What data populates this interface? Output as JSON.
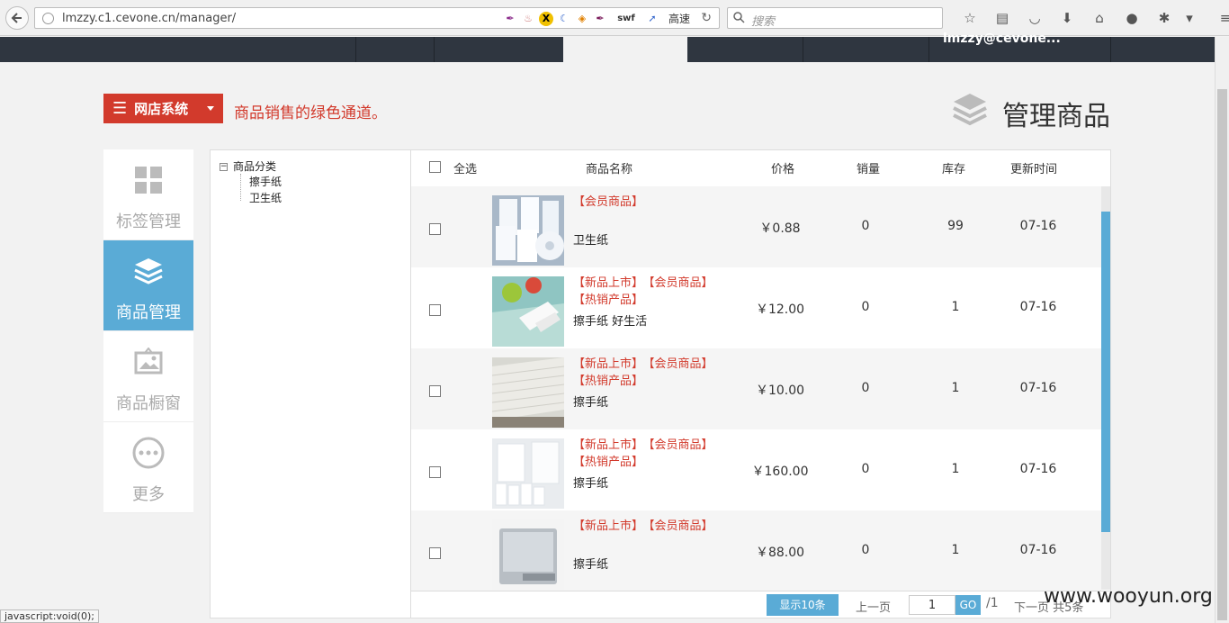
{
  "browser": {
    "url": "lmzzy.c1.cevone.cn/manager/",
    "speed_label": "高速",
    "search_placeholder": "搜索"
  },
  "header": {
    "user": "lmzzy@cevone..."
  },
  "page": {
    "system_button": "网店系统",
    "slogan": "商品销售的绿色通道。",
    "title": "管理商品"
  },
  "left_menu": {
    "items": [
      {
        "label": "标签管理",
        "icon": "grid-icon"
      },
      {
        "label": "商品管理",
        "icon": "layers-icon"
      },
      {
        "label": "商品橱窗",
        "icon": "picture-icon"
      },
      {
        "label": "更多",
        "icon": "more-icon"
      }
    ]
  },
  "tree": {
    "root": "商品分类",
    "children": [
      "擦手纸",
      "卫生纸"
    ]
  },
  "table": {
    "headers": {
      "select_all": "全选",
      "name": "商品名称",
      "price": "价格",
      "sales": "销量",
      "stock": "库存",
      "updated": "更新时间"
    },
    "rows": [
      {
        "tags": [
          "【会员商品】"
        ],
        "name": "卫生纸",
        "price": "￥0.88",
        "sales": "0",
        "stock": "99",
        "updated": "07-16"
      },
      {
        "tags": [
          "【新品上市】",
          "【会员商品】",
          "【热销产品】"
        ],
        "name": "擦手纸 好生活",
        "price": "￥12.00",
        "sales": "0",
        "stock": "1",
        "updated": "07-16"
      },
      {
        "tags": [
          "【新品上市】",
          "【会员商品】",
          "【热销产品】"
        ],
        "name": "擦手纸",
        "price": "￥10.00",
        "sales": "0",
        "stock": "1",
        "updated": "07-16"
      },
      {
        "tags": [
          "【新品上市】",
          "【会员商品】",
          "【热销产品】"
        ],
        "name": "擦手纸",
        "price": "￥160.00",
        "sales": "0",
        "stock": "1",
        "updated": "07-16"
      },
      {
        "tags": [
          "【新品上市】",
          "【会员商品】"
        ],
        "name": "擦手纸",
        "price": "￥88.00",
        "sales": "0",
        "stock": "1",
        "updated": "07-16"
      }
    ]
  },
  "pager": {
    "show_count": "显示10条",
    "prev": "上一页",
    "page_value": "1",
    "go": "GO",
    "total": "/1",
    "next": "下一页 共5条"
  },
  "status_bar": "javascript:void(0);",
  "watermark": "www.wooyun.org",
  "colors": {
    "accent_red": "#d23a2c",
    "accent_blue": "#5aabd6",
    "header_dark": "#2f3640"
  }
}
